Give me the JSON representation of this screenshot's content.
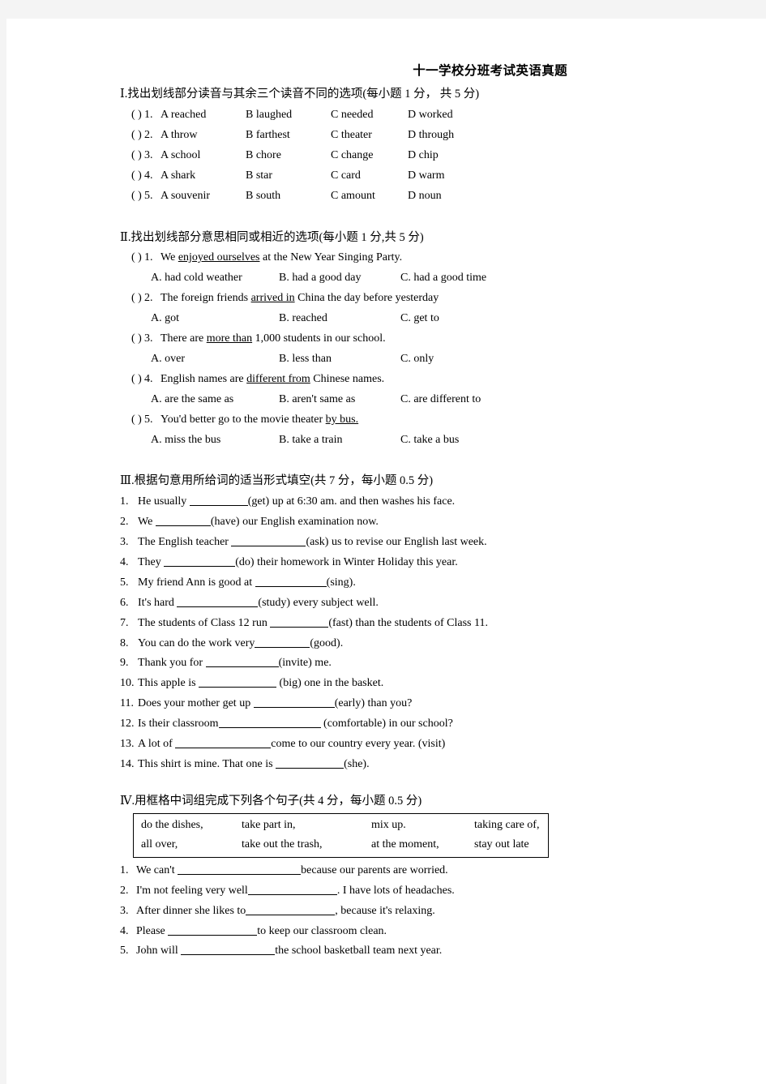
{
  "document": {
    "title": "十一学校分班考试英语真题"
  },
  "sections": [
    {
      "heading": "Ⅰ.找出划线部分读音与其余三个读音不同的选项(每小题 1 分， 共 5 分)",
      "type": "pronunciation",
      "questions": [
        {
          "marker": "(    )",
          "number": "1.",
          "options": [
            "A  reached",
            "B  laughed",
            "C  needed",
            "D  worked"
          ]
        },
        {
          "marker": "(    )",
          "number": "2.",
          "options": [
            "A  throw",
            "B  farthest",
            "C  theater",
            "D  through"
          ]
        },
        {
          "marker": "(    )",
          "number": "3.",
          "options": [
            "A  school",
            "B  chore",
            "C  change",
            "D  chip"
          ]
        },
        {
          "marker": "(    )",
          "number": "4.",
          "options": [
            "A  shark",
            "B  star",
            "C  card",
            "D  warm"
          ]
        },
        {
          "marker": "(    )",
          "number": "5.",
          "options": [
            "A  souvenir",
            "B  south",
            "C  amount",
            "D  noun"
          ]
        }
      ]
    },
    {
      "heading": "Ⅱ.找出划线部分意思相同或相近的选项(每小题 1 分,共 5 分)",
      "type": "synonym",
      "questions": [
        {
          "marker": "(    )",
          "number": "1.",
          "stem_pre": "We ",
          "stem_underline": "enjoyed ourselves",
          "stem_post": " at the New Year Singing Party.",
          "options": [
            "A. had cold weather",
            "B. had a good day",
            "C. had a good time"
          ]
        },
        {
          "marker": "(    )",
          "number": "2.",
          "stem_pre": "The foreign friends ",
          "stem_underline": "arrived in",
          "stem_post": " China the day before yesterday",
          "options": [
            "A. got",
            "B. reached",
            "C. get to"
          ]
        },
        {
          "marker": "(    )",
          "number": "3.",
          "stem_pre": "There are ",
          "stem_underline": "more than",
          "stem_post": " 1,000 students in our school.",
          "options": [
            "A. over",
            "B. less than",
            "C. only"
          ]
        },
        {
          "marker": "(    )",
          "number": "4.",
          "stem_pre": "English names are ",
          "stem_underline": "different from",
          "stem_post": " Chinese names.",
          "options": [
            "A. are the same as",
            "B. aren't same as",
            "C. are different to"
          ]
        },
        {
          "marker": "(    )",
          "number": "5.",
          "stem_pre": "You'd better go to the movie theater ",
          "stem_underline": "by bus.",
          "stem_post": "",
          "options": [
            "A. miss the bus",
            "B. take a train",
            "C. take a bus"
          ]
        }
      ]
    },
    {
      "heading": "Ⅲ.根据句意用所给词的适当形式填空(共 7 分，每小题 0.5 分)",
      "type": "fill-in-blank",
      "items": [
        {
          "number": "1.",
          "before": "He usually ",
          "blank_width": 72,
          "after": "(get) up at 6:30 am. and then washes his face."
        },
        {
          "number": "2.",
          "before": "We  ",
          "blank_width": 68,
          "after": "(have) our English examination now."
        },
        {
          "number": "3.",
          "before": "The English teacher ",
          "blank_width": 92,
          "after": "(ask) us to revise our English last week."
        },
        {
          "number": "4.",
          "before": "They ",
          "blank_width": 88,
          "after": "(do) their homework in Winter Holiday this year."
        },
        {
          "number": "5.",
          "before": "My friend Ann is good at ",
          "blank_width": 88,
          "after": "(sing)."
        },
        {
          "number": "6.",
          "before": "It's hard ",
          "blank_width": 100,
          "after": "(study) every subject well."
        },
        {
          "number": "7.",
          "before": "The students of Class 12 run ",
          "blank_width": 72,
          "after": "(fast) than the students of Class 11."
        },
        {
          "number": "8.",
          "before": "You can do the work very",
          "blank_width": 68,
          "after": "(good)."
        },
        {
          "number": "9.",
          "before": "Thank you for ",
          "blank_width": 90,
          "after": "(invite) me."
        },
        {
          "number": "10.",
          "before": "This apple is ",
          "blank_width": 96,
          "after": " (big) one in the basket."
        },
        {
          "number": "11.",
          "before": "Does your mother get up ",
          "blank_width": 100,
          "after": "(early) than you?"
        },
        {
          "number": "12.",
          "before": "Is their classroom",
          "blank_width": 126,
          "after": " (comfortable) in our school?"
        },
        {
          "number": "13.",
          "before": "A lot of ",
          "blank_width": 118,
          "after": "come to our country every year. (visit)"
        },
        {
          "number": "14.",
          "before": "This shirt is mine. That one is ",
          "blank_width": 84,
          "after": "(she)."
        }
      ]
    },
    {
      "heading": "Ⅳ.用框格中词组完成下列各个句子(共 4 分，每小题 0.5 分)",
      "type": "word-bank",
      "word_bank": {
        "row1": [
          "do the dishes,",
          "take part in,",
          "mix up.",
          "taking care of,"
        ],
        "row2": [
          "all over,",
          "take out the trash,",
          "at the moment,",
          "stay out late"
        ]
      },
      "items": [
        {
          "number": "1.",
          "before": "We can't  ",
          "blank_width": 152,
          "after": "because our parents are worried."
        },
        {
          "number": "2.",
          "before": "I'm not feeling very well",
          "blank_width": 110,
          "after": ". I have lots of headaches."
        },
        {
          "number": "3.",
          "before": "After dinner she likes to",
          "blank_width": 110,
          "after": ", because it's relaxing."
        },
        {
          "number": "4.",
          "before": "Please ",
          "blank_width": 110,
          "after": "to keep our classroom clean."
        },
        {
          "number": "5.",
          "before": "John will ",
          "blank_width": 116,
          "after": "the school basketball team next year."
        }
      ]
    }
  ]
}
